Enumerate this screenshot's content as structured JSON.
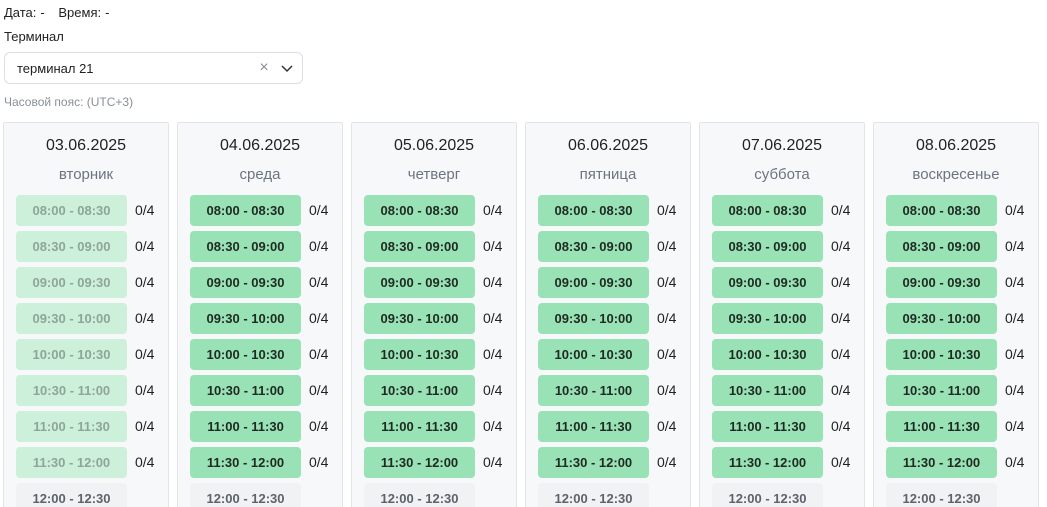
{
  "header": {
    "date_label": "Дата:",
    "date_value": "-",
    "time_label": "Время:",
    "time_value": "-"
  },
  "terminal": {
    "label": "Терминал",
    "selected": "терминал 21"
  },
  "timezone": "Часовой пояс: (UTC+3)",
  "days": [
    {
      "date": "03.06.2025",
      "weekday": "вторник",
      "slots": [
        {
          "time": "08:00 - 08:30",
          "count": "0/4",
          "state": "past"
        },
        {
          "time": "08:30 - 09:00",
          "count": "0/4",
          "state": "past"
        },
        {
          "time": "09:00 - 09:30",
          "count": "0/4",
          "state": "past"
        },
        {
          "time": "09:30 - 10:00",
          "count": "0/4",
          "state": "past"
        },
        {
          "time": "10:00 - 10:30",
          "count": "0/4",
          "state": "past"
        },
        {
          "time": "10:30 - 11:00",
          "count": "0/4",
          "state": "past"
        },
        {
          "time": "11:00 - 11:30",
          "count": "0/4",
          "state": "past"
        },
        {
          "time": "11:30 - 12:00",
          "count": "0/4",
          "state": "past"
        },
        {
          "time": "12:00 - 12:30",
          "count": "",
          "state": "closed"
        }
      ]
    },
    {
      "date": "04.06.2025",
      "weekday": "среда",
      "slots": [
        {
          "time": "08:00 - 08:30",
          "count": "0/4",
          "state": "available"
        },
        {
          "time": "08:30 - 09:00",
          "count": "0/4",
          "state": "available"
        },
        {
          "time": "09:00 - 09:30",
          "count": "0/4",
          "state": "available"
        },
        {
          "time": "09:30 - 10:00",
          "count": "0/4",
          "state": "available"
        },
        {
          "time": "10:00 - 10:30",
          "count": "0/4",
          "state": "available"
        },
        {
          "time": "10:30 - 11:00",
          "count": "0/4",
          "state": "available"
        },
        {
          "time": "11:00 - 11:30",
          "count": "0/4",
          "state": "available"
        },
        {
          "time": "11:30 - 12:00",
          "count": "0/4",
          "state": "available"
        },
        {
          "time": "12:00 - 12:30",
          "count": "",
          "state": "closed"
        }
      ]
    },
    {
      "date": "05.06.2025",
      "weekday": "четверг",
      "slots": [
        {
          "time": "08:00 - 08:30",
          "count": "0/4",
          "state": "available"
        },
        {
          "time": "08:30 - 09:00",
          "count": "0/4",
          "state": "available"
        },
        {
          "time": "09:00 - 09:30",
          "count": "0/4",
          "state": "available"
        },
        {
          "time": "09:30 - 10:00",
          "count": "0/4",
          "state": "available"
        },
        {
          "time": "10:00 - 10:30",
          "count": "0/4",
          "state": "available"
        },
        {
          "time": "10:30 - 11:00",
          "count": "0/4",
          "state": "available"
        },
        {
          "time": "11:00 - 11:30",
          "count": "0/4",
          "state": "available"
        },
        {
          "time": "11:30 - 12:00",
          "count": "0/4",
          "state": "available"
        },
        {
          "time": "12:00 - 12:30",
          "count": "",
          "state": "closed"
        }
      ]
    },
    {
      "date": "06.06.2025",
      "weekday": "пятница",
      "slots": [
        {
          "time": "08:00 - 08:30",
          "count": "0/4",
          "state": "available"
        },
        {
          "time": "08:30 - 09:00",
          "count": "0/4",
          "state": "available"
        },
        {
          "time": "09:00 - 09:30",
          "count": "0/4",
          "state": "available"
        },
        {
          "time": "09:30 - 10:00",
          "count": "0/4",
          "state": "available"
        },
        {
          "time": "10:00 - 10:30",
          "count": "0/4",
          "state": "available"
        },
        {
          "time": "10:30 - 11:00",
          "count": "0/4",
          "state": "available"
        },
        {
          "time": "11:00 - 11:30",
          "count": "0/4",
          "state": "available"
        },
        {
          "time": "11:30 - 12:00",
          "count": "0/4",
          "state": "available"
        },
        {
          "time": "12:00 - 12:30",
          "count": "",
          "state": "closed"
        }
      ]
    },
    {
      "date": "07.06.2025",
      "weekday": "суббота",
      "slots": [
        {
          "time": "08:00 - 08:30",
          "count": "0/4",
          "state": "available"
        },
        {
          "time": "08:30 - 09:00",
          "count": "0/4",
          "state": "available"
        },
        {
          "time": "09:00 - 09:30",
          "count": "0/4",
          "state": "available"
        },
        {
          "time": "09:30 - 10:00",
          "count": "0/4",
          "state": "available"
        },
        {
          "time": "10:00 - 10:30",
          "count": "0/4",
          "state": "available"
        },
        {
          "time": "10:30 - 11:00",
          "count": "0/4",
          "state": "available"
        },
        {
          "time": "11:00 - 11:30",
          "count": "0/4",
          "state": "available"
        },
        {
          "time": "11:30 - 12:00",
          "count": "0/4",
          "state": "available"
        },
        {
          "time": "12:00 - 12:30",
          "count": "",
          "state": "closed"
        }
      ]
    },
    {
      "date": "08.06.2025",
      "weekday": "воскресенье",
      "slots": [
        {
          "time": "08:00 - 08:30",
          "count": "0/4",
          "state": "available"
        },
        {
          "time": "08:30 - 09:00",
          "count": "0/4",
          "state": "available"
        },
        {
          "time": "09:00 - 09:30",
          "count": "0/4",
          "state": "available"
        },
        {
          "time": "09:30 - 10:00",
          "count": "0/4",
          "state": "available"
        },
        {
          "time": "10:00 - 10:30",
          "count": "0/4",
          "state": "available"
        },
        {
          "time": "10:30 - 11:00",
          "count": "0/4",
          "state": "available"
        },
        {
          "time": "11:00 - 11:30",
          "count": "0/4",
          "state": "available"
        },
        {
          "time": "11:30 - 12:00",
          "count": "0/4",
          "state": "available"
        },
        {
          "time": "12:00 - 12:30",
          "count": "",
          "state": "closed"
        }
      ]
    }
  ]
}
